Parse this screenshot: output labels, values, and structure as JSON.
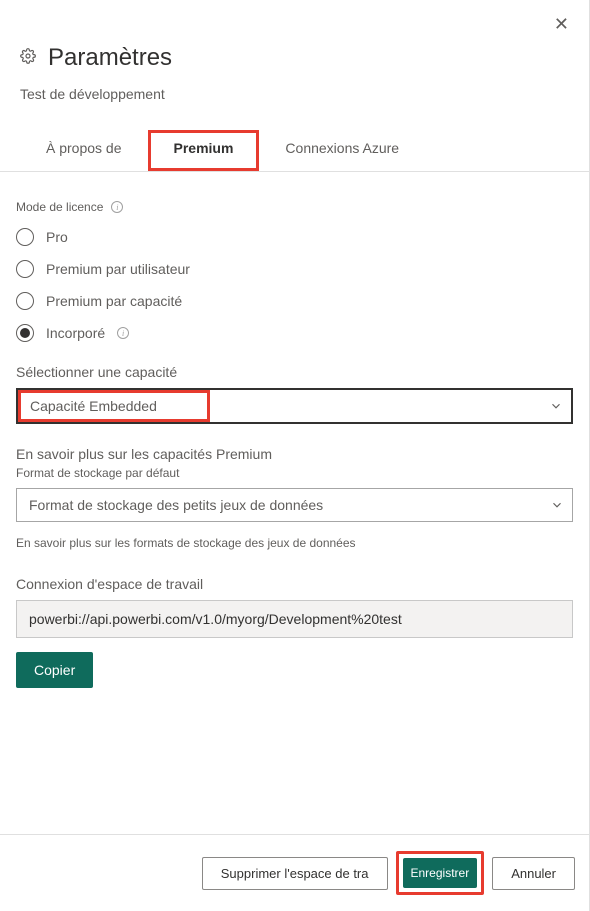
{
  "header": {
    "title": "Paramètres",
    "subtitle": "Test de développement"
  },
  "tabs": {
    "about": "À propos de",
    "premium": "Premium",
    "azure": "Connexions Azure"
  },
  "license": {
    "label": "Mode de licence",
    "options": {
      "pro": "Pro",
      "ppu": "Premium par utilisateur",
      "ppc": "Premium par capacité",
      "embedded": "Incorporé"
    }
  },
  "capacity": {
    "label": "Sélectionner une capacité",
    "value": "Capacité Embedded"
  },
  "premium_help": "En savoir plus sur les capacités Premium",
  "storage": {
    "label": "Format de stockage par défaut",
    "value": "Format de stockage des petits jeux de données",
    "help": "En savoir plus sur les formats de stockage des jeux de données"
  },
  "workspace": {
    "label": "Connexion d'espace de travail",
    "value": "powerbi://api.powerbi.com/v1.0/myorg/Development%20test",
    "copy": "Copier"
  },
  "footer": {
    "delete": "Supprimer l'espace de tra",
    "save": "Enregistrer",
    "cancel": "Annuler"
  }
}
